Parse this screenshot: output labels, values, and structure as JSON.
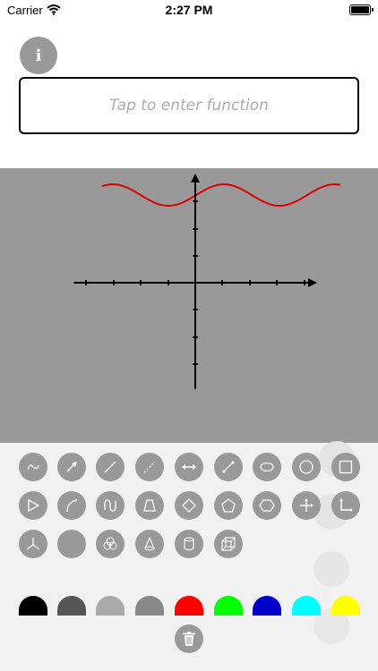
{
  "status_bar": {
    "carrier": "Carrier",
    "time": "2:27 PM",
    "wifi_icon": "wifi-icon",
    "battery_icon": "battery-icon"
  },
  "info_button": {
    "label": "i",
    "icon": "info-icon"
  },
  "function_input": {
    "placeholder": "Tap to enter function",
    "value": ""
  },
  "graph": {
    "background": "#999999",
    "curve_color": "#dd0000",
    "axis_color": "#000000",
    "curve": "sine wave"
  },
  "toolbar": {
    "row1": [
      "freehand-tool",
      "arrow-tool",
      "line-tool",
      "dashed-line-tool",
      "double-arrow-tool",
      "segment-tool",
      "ellipse-tool",
      "circle-tool",
      "square-tool"
    ],
    "row2": [
      "triangle-tool",
      "arc-tool",
      "curve-tool",
      "trapezoid-tool",
      "rhombus-tool",
      "pentagon-tool",
      "hexagon-tool",
      "axes-tool",
      "right-angle-tool"
    ],
    "row3": [
      "3d-axes-tool",
      "filled-circle-tool",
      "venn-tool",
      "cone-tool",
      "cylinder-tool",
      "cube-tool"
    ]
  },
  "colors": [
    "#000000",
    "#555555",
    "#aaaaaa",
    "#888888",
    "#ff0000",
    "#00ff00",
    "#0000cc",
    "#00ffff",
    "#ffff00"
  ],
  "trash_icon": "trash-icon"
}
